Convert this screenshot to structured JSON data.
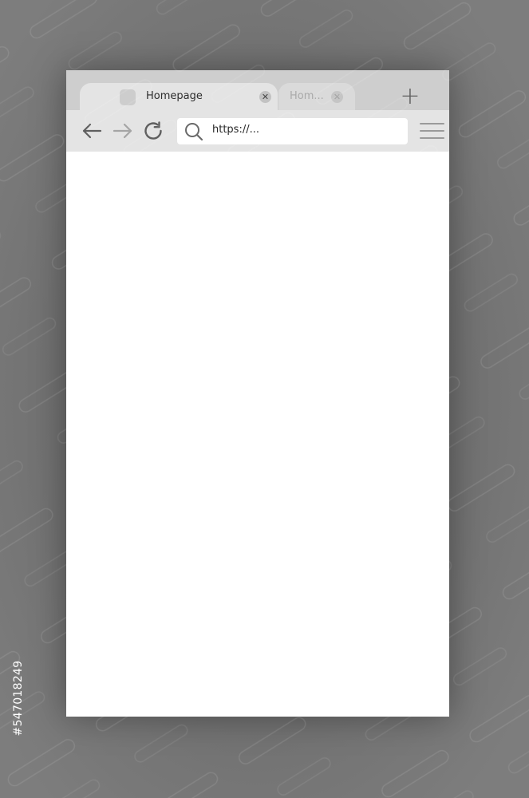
{
  "tabs": [
    {
      "title": "Homepage",
      "close_glyph": "✕",
      "active": true
    },
    {
      "title": "Hom...",
      "close_glyph": "✕",
      "active": false
    }
  ],
  "new_tab_glyph": "+",
  "toolbar": {
    "back_icon": "arrow-left-icon",
    "forward_icon": "arrow-right-icon",
    "reload_icon": "reload-icon",
    "menu_icon": "hamburger-menu-icon"
  },
  "address_bar": {
    "value": "https://..."
  },
  "stock_id": "#547018249",
  "colors": {
    "background": "#6c6c6c",
    "tab_strip": "#cecece",
    "active_tab": "#e4e4e4",
    "inactive_tab": "#dadada",
    "toolbar": "#e4e4e4",
    "content": "#ffffff",
    "icon_dark": "#5f5f5f",
    "icon_light": "#a5a5a5"
  }
}
